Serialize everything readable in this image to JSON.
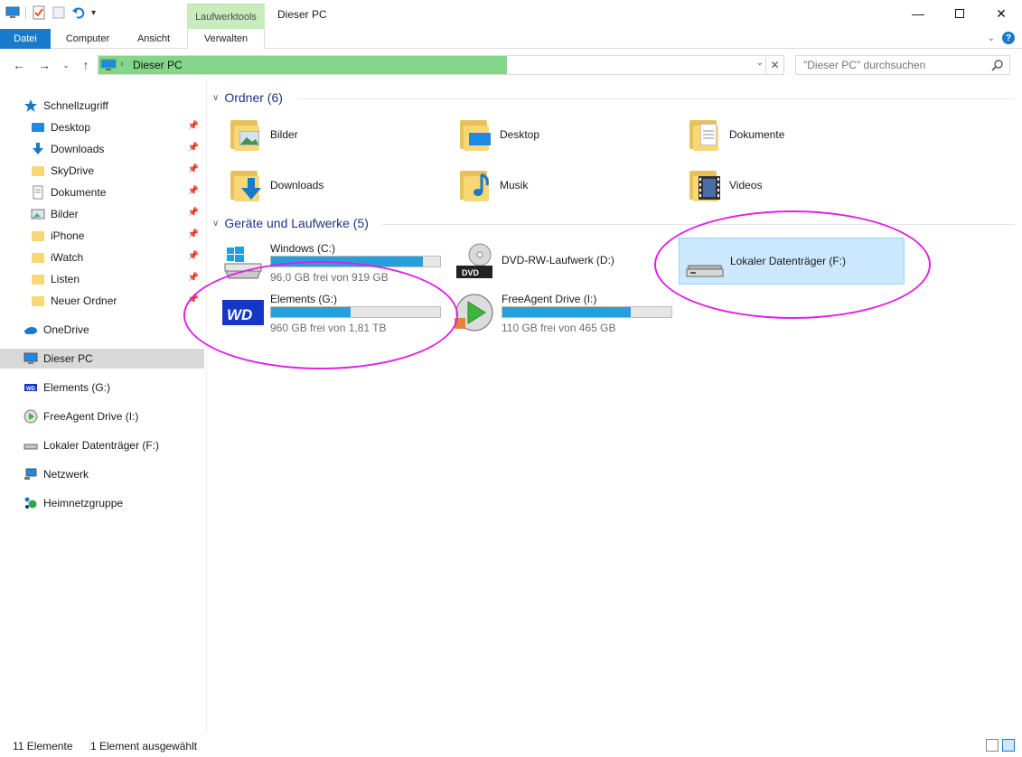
{
  "window": {
    "title": "Dieser PC",
    "context_tab_group": "Laufwerktools"
  },
  "ribbon": {
    "tabs": [
      "Datei",
      "Computer",
      "Ansicht",
      "Verwalten"
    ]
  },
  "address": {
    "location": "Dieser PC",
    "search_placeholder": "\"Dieser PC\" durchsuchen"
  },
  "navigation": {
    "quick_access": "Schnellzugriff",
    "quick_items": [
      {
        "label": "Desktop",
        "icon": "desktop-icon"
      },
      {
        "label": "Downloads",
        "icon": "downloads-icon"
      },
      {
        "label": "SkyDrive",
        "icon": "folder-icon"
      },
      {
        "label": "Dokumente",
        "icon": "documents-icon"
      },
      {
        "label": "Bilder",
        "icon": "pictures-icon"
      },
      {
        "label": "iPhone",
        "icon": "folder-icon"
      },
      {
        "label": "iWatch",
        "icon": "folder-icon"
      },
      {
        "label": "Listen",
        "icon": "folder-icon"
      },
      {
        "label": "Neuer Ordner",
        "icon": "folder-icon"
      }
    ],
    "onedrive": "OneDrive",
    "this_pc": "Dieser PC",
    "elements": "Elements (G:)",
    "freeagent": "FreeAgent Drive (I:)",
    "local_disk": "Lokaler Datenträger (F:)",
    "network": "Netzwerk",
    "homegroup": "Heimnetzgruppe"
  },
  "folders_group": {
    "title": "Ordner (6)",
    "items": [
      {
        "name": "Bilder",
        "icon": "pictures-folder-icon"
      },
      {
        "name": "Desktop",
        "icon": "desktop-folder-icon"
      },
      {
        "name": "Dokumente",
        "icon": "documents-folder-icon"
      },
      {
        "name": "Downloads",
        "icon": "downloads-folder-icon"
      },
      {
        "name": "Musik",
        "icon": "music-folder-icon"
      },
      {
        "name": "Videos",
        "icon": "videos-folder-icon"
      }
    ]
  },
  "drives_group": {
    "title": "Geräte und Laufwerke (5)",
    "drives": [
      {
        "name": "Windows (C:)",
        "free": "96,0 GB frei von 919 GB",
        "used_fraction": 0.9,
        "icon": "windows-drive-icon"
      },
      {
        "name": "DVD-RW-Laufwerk (D:)",
        "icon": "dvd-drive-icon"
      },
      {
        "name": "Lokaler Datenträger (F:)",
        "icon": "local-disk-icon"
      },
      {
        "name": "Elements (G:)",
        "free": "960 GB frei von 1,81 TB",
        "used_fraction": 0.47,
        "icon": "wd-drive-icon"
      },
      {
        "name": "FreeAgent Drive (I:)",
        "free": "110 GB frei von 465 GB",
        "used_fraction": 0.76,
        "icon": "freeagent-drive-icon"
      }
    ]
  },
  "status": {
    "count": "11 Elemente",
    "selection": "1 Element ausgewählt"
  },
  "colors": {
    "accent": "#1979ca",
    "address_highlight": "#83d68a",
    "annotation_ellipse": "#e020e8",
    "bar_fill": "#26a0da"
  }
}
